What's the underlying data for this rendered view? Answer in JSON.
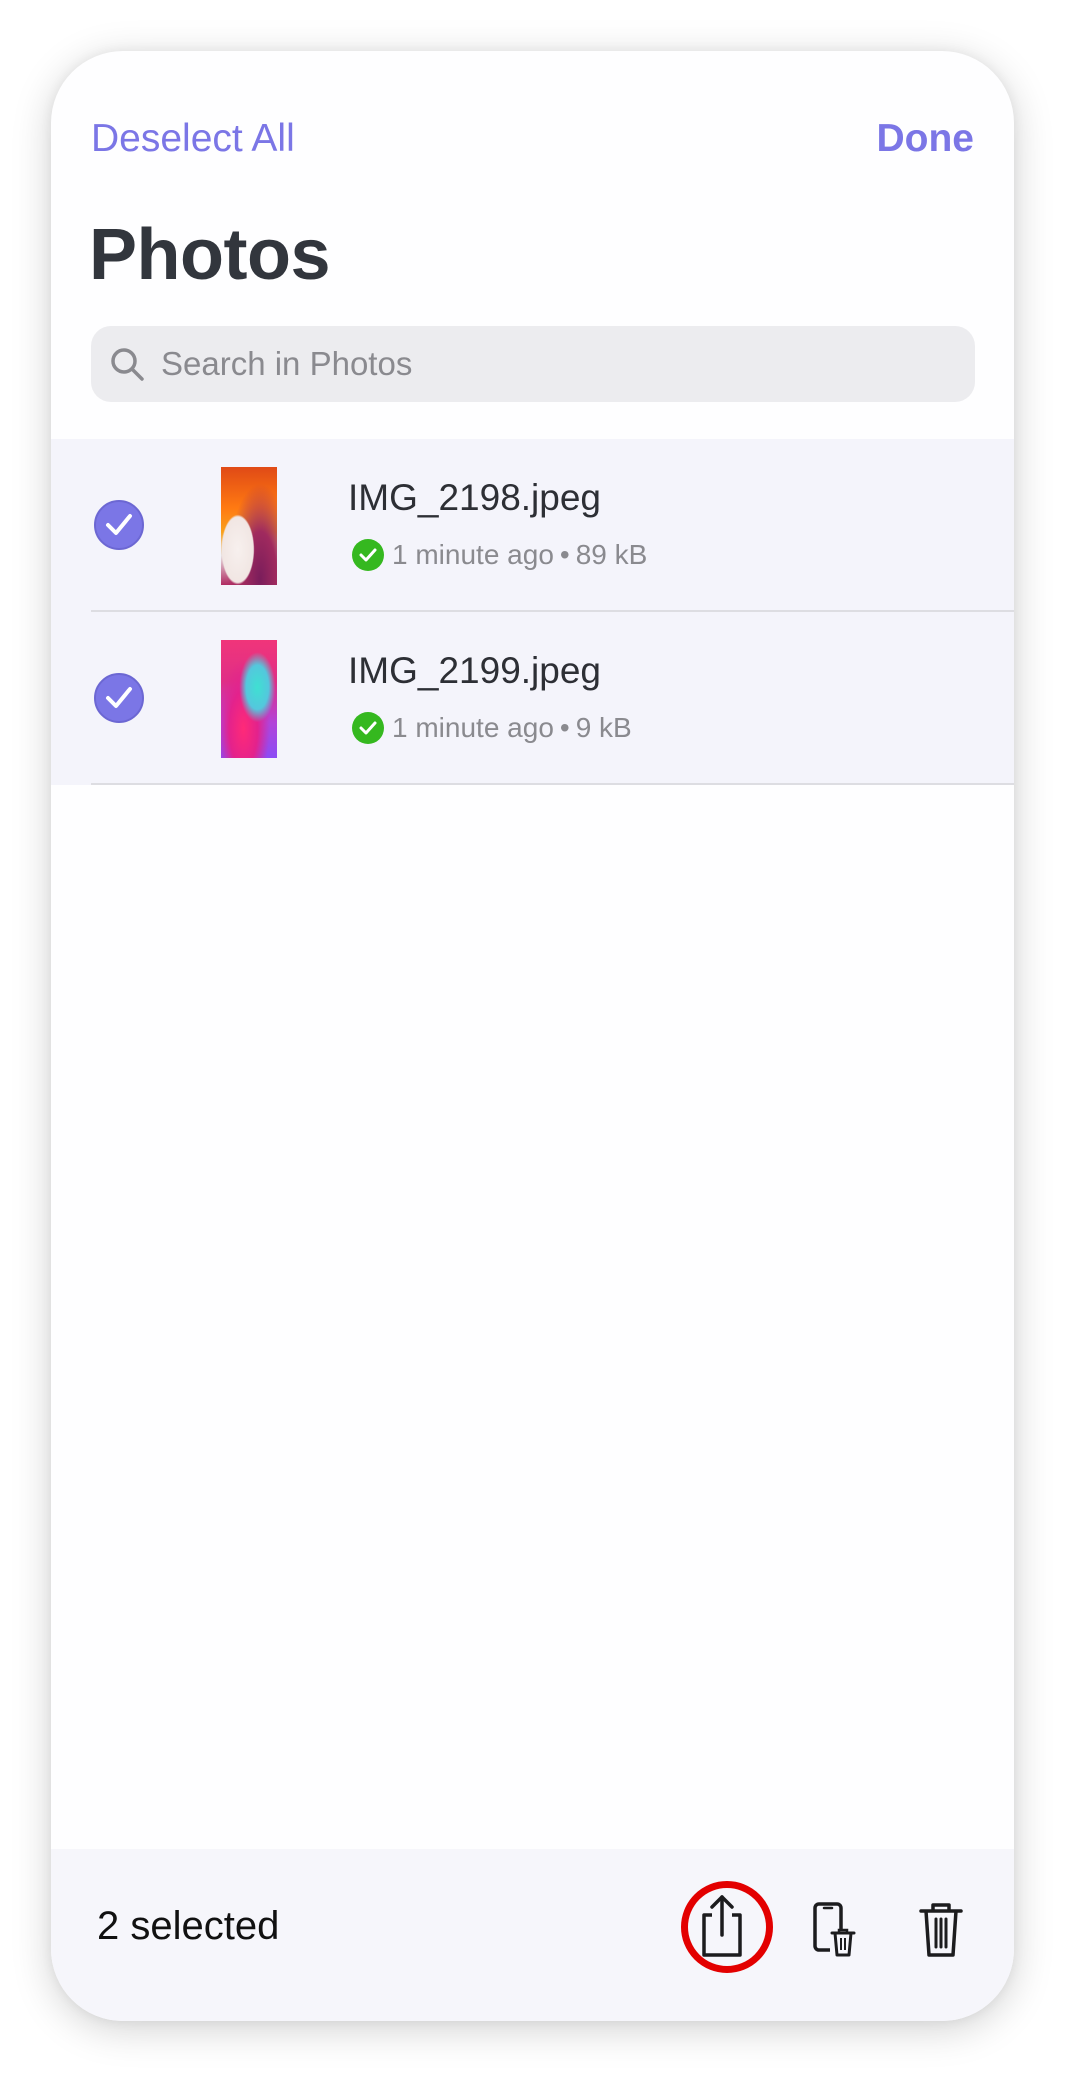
{
  "header": {
    "deselect_label": "Deselect All",
    "done_label": "Done",
    "title": "Photos"
  },
  "search": {
    "placeholder": "Search in Photos",
    "value": ""
  },
  "files": [
    {
      "name": "IMG_2198.jpeg",
      "modified": "1 minute ago",
      "separator": "•",
      "size": "89 kB",
      "selected": true,
      "status_icon": "checkmark-circle-icon"
    },
    {
      "name": "IMG_2199.jpeg",
      "modified": "1 minute ago",
      "separator": "•",
      "size": "9 kB",
      "selected": true,
      "status_icon": "checkmark-circle-icon"
    }
  ],
  "toolbar": {
    "selected_count_label": "2 selected",
    "share_icon": "share-icon",
    "offload_icon": "remove-from-device-icon",
    "trash_icon": "trash-icon",
    "highlighted": "share-button"
  },
  "colors": {
    "accent": "#7b76e6",
    "status_ok": "#35b81f",
    "highlight": "#e30000",
    "title": "#32363d"
  }
}
